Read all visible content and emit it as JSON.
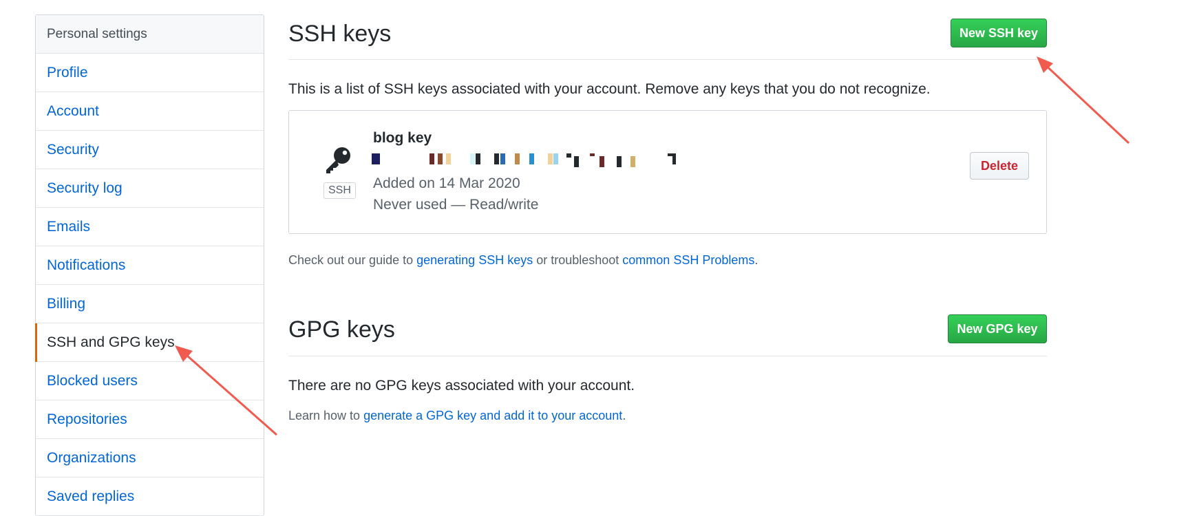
{
  "sidebar": {
    "header": "Personal settings",
    "items": [
      {
        "label": "Profile"
      },
      {
        "label": "Account"
      },
      {
        "label": "Security"
      },
      {
        "label": "Security log"
      },
      {
        "label": "Emails"
      },
      {
        "label": "Notifications"
      },
      {
        "label": "Billing"
      },
      {
        "label": "SSH and GPG keys",
        "selected": true
      },
      {
        "label": "Blocked users"
      },
      {
        "label": "Repositories"
      },
      {
        "label": "Organizations"
      },
      {
        "label": "Saved replies"
      }
    ]
  },
  "ssh": {
    "title": "SSH keys",
    "new_button": "New SSH key",
    "intro": "This is a list of SSH keys associated with your account. Remove any keys that you do not recognize.",
    "key": {
      "name": "blog key",
      "badge": "SSH",
      "added": "Added on 14 Mar 2020",
      "usage": "Never used — Read/write",
      "delete_label": "Delete",
      "icon": "key-icon"
    },
    "guide": {
      "prefix": "Check out our guide to ",
      "link1": "generating SSH keys",
      "middle": " or troubleshoot ",
      "link2": "common SSH Problems",
      "suffix": "."
    }
  },
  "gpg": {
    "title": "GPG keys",
    "new_button": "New GPG key",
    "empty": "There are no GPG keys associated with your account.",
    "learn": {
      "prefix": "Learn how to ",
      "link": "generate a GPG key and add it to your account",
      "suffix": "."
    }
  },
  "colors": {
    "accent_green": "#28a745",
    "link_blue": "#0366d6",
    "danger_red": "#cb2431",
    "selected_marker": "#e36209",
    "annotation_arrow": "#f05a4f"
  }
}
